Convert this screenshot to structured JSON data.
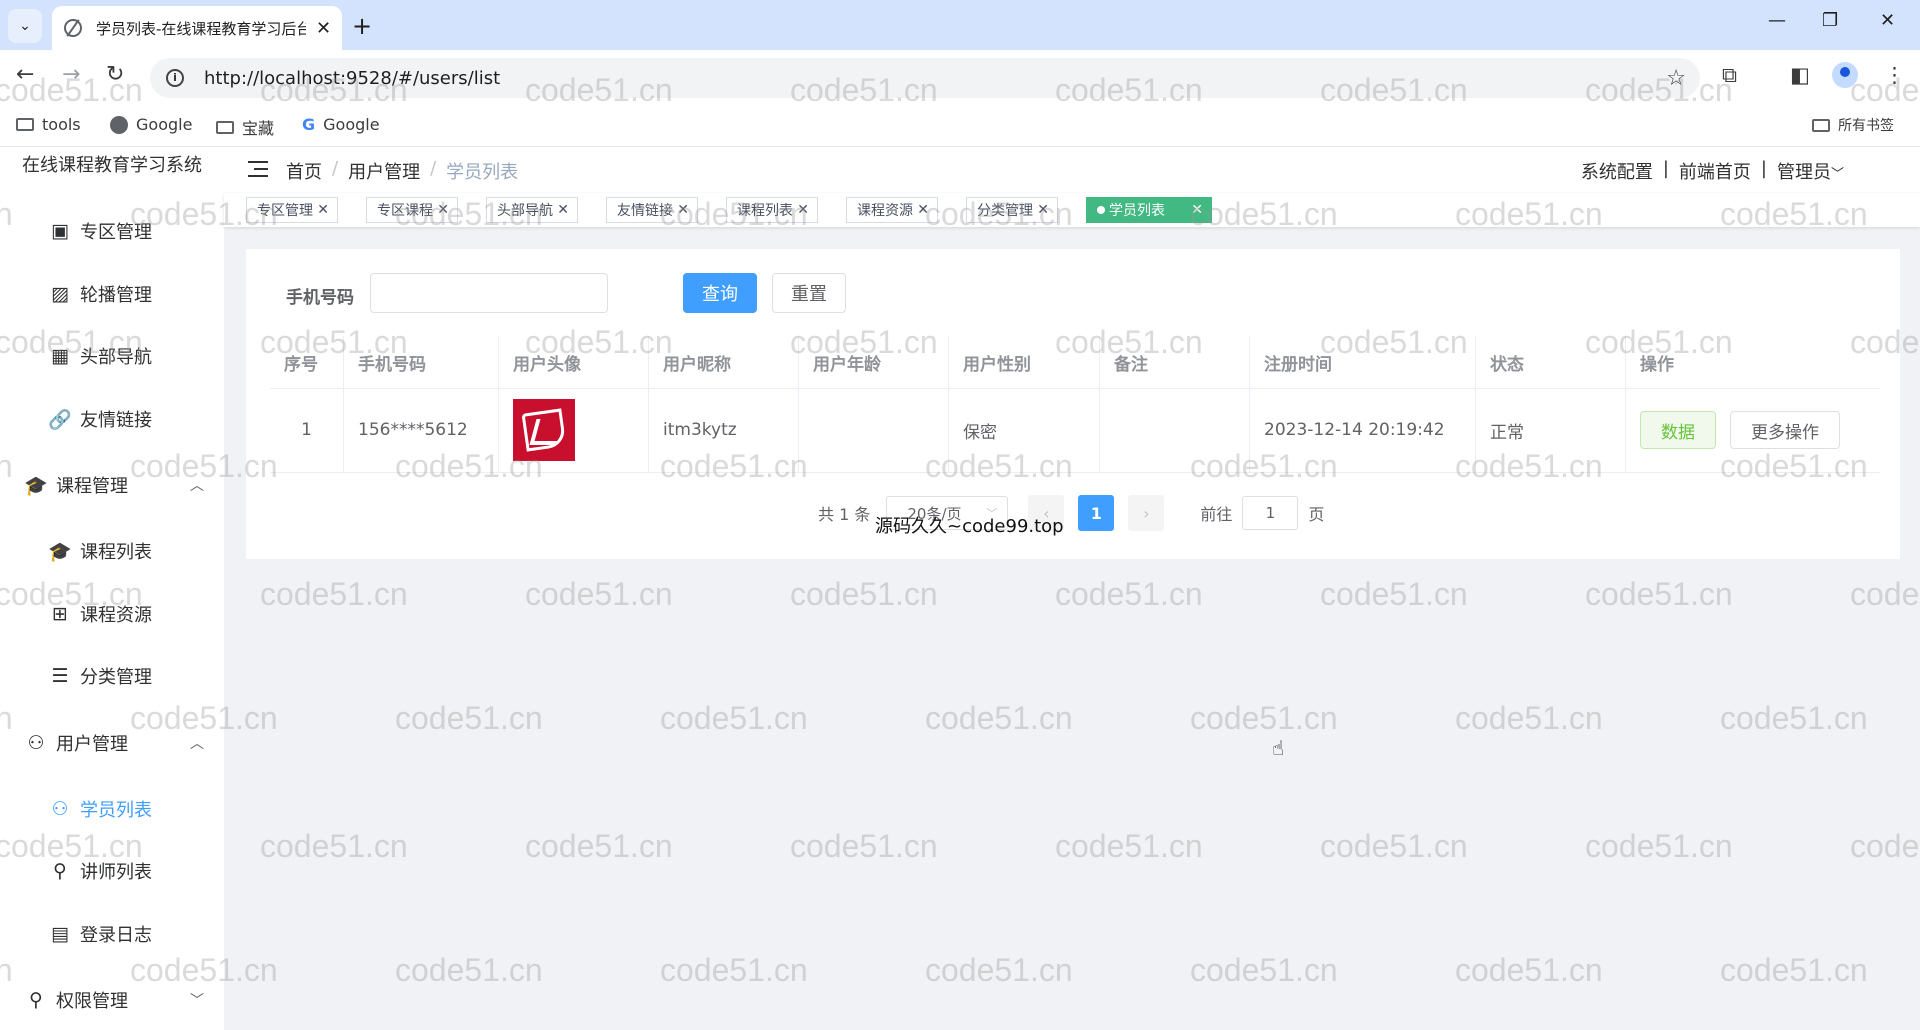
{
  "browser": {
    "tab_title": "学员列表-在线课程教育学习后台",
    "url": "http://localhost:9528/#/users/list",
    "bookmarks": [
      "tools",
      "Google",
      "宝藏",
      "Google"
    ],
    "all_bookmarks": "所有书签"
  },
  "app": {
    "system_title": "在线课程教育学习系统",
    "breadcrumb": [
      "首页",
      "用户管理",
      "学员列表"
    ],
    "breadcrumb_sep": "/",
    "top_links": [
      "系统配置",
      "前端首页",
      "管理员"
    ],
    "top_sep": "|"
  },
  "sidebar": {
    "items": [
      {
        "label": "专区管理",
        "icon": "zone-icon"
      },
      {
        "label": "轮播管理",
        "icon": "image-icon"
      },
      {
        "label": "头部导航",
        "icon": "calendar-icon"
      },
      {
        "label": "友情链接",
        "icon": "link-icon"
      },
      {
        "label": "课程管理",
        "icon": "graduation-cap-icon",
        "group": true,
        "expanded": true
      },
      {
        "label": "课程列表",
        "icon": "graduation-cap-icon"
      },
      {
        "label": "课程资源",
        "icon": "grid-icon"
      },
      {
        "label": "分类管理",
        "icon": "list-icon"
      },
      {
        "label": "用户管理",
        "icon": "users-icon",
        "group": true,
        "expanded": true
      },
      {
        "label": "学员列表",
        "icon": "users-icon",
        "active": true
      },
      {
        "label": "讲师列表",
        "icon": "user-icon"
      },
      {
        "label": "登录日志",
        "icon": "document-icon"
      },
      {
        "label": "权限管理",
        "icon": "user-icon",
        "group": true,
        "expanded": false
      }
    ]
  },
  "tags": [
    "专区管理",
    "专区课程",
    "头部导航",
    "友情链接",
    "课程列表",
    "课程资源",
    "分类管理",
    "学员列表"
  ],
  "search": {
    "label": "手机号码",
    "value": "",
    "query_button": "查询",
    "reset_button": "重置"
  },
  "table": {
    "headers": [
      "序号",
      "手机号码",
      "用户头像",
      "用户昵称",
      "用户年龄",
      "用户性别",
      "备注",
      "注册时间",
      "状态",
      "操作"
    ],
    "rows": [
      {
        "index": "1",
        "phone": "156****5612",
        "nickname": "itm3kytz",
        "age": "",
        "gender": "保密",
        "remark": "",
        "registered": "2023-12-14 20:19:42",
        "status": "正常",
        "op_data": "数据",
        "op_more": "更多操作"
      }
    ]
  },
  "pagination": {
    "total_text": "共 1 条",
    "page_size": "20条/页",
    "current_page": "1",
    "goto_label": "前往",
    "goto_value": "1",
    "page_suffix": "页"
  },
  "overlay_text": "源码久久~code99.top",
  "watermark": "code51.cn",
  "colors": {
    "primary": "#409eff",
    "active_tag": "#42b983",
    "success_text": "#67c23a"
  }
}
